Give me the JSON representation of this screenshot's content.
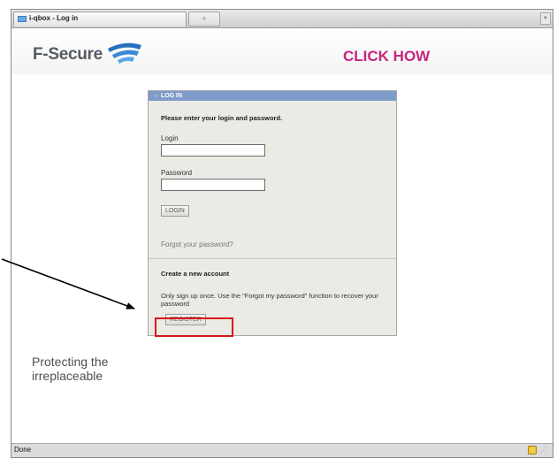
{
  "browser": {
    "tab_title": "i-qbox - Log in",
    "new_tab_glyph": "+",
    "menu_glyph": "▼"
  },
  "header": {
    "brand": "F-Secure",
    "brand_icon": "f-secure-logo-icon",
    "annotation": "CLICK HOW",
    "annotation_color": "#c8247f"
  },
  "login": {
    "panel_title": "→ LOG IN",
    "instructions": "Please enter your login and password.",
    "login_label": "Login",
    "login_value": "",
    "password_label": "Password",
    "password_value": "",
    "login_button": "LOGIN",
    "forgot_link": "Forgot your password?"
  },
  "register": {
    "heading": "Create a new account",
    "description": "Only sign up once. Use the \"Forgot my password\" function to recover your password",
    "register_button": "REGISTER",
    "highlight_color": "#d9141b"
  },
  "tagline": "Protecting the irreplaceable",
  "status": {
    "text": "Done",
    "lock_icon": "lock-icon",
    "grip_glyph": "⋰"
  },
  "colors": {
    "panel_header": "#7f9bc9",
    "panel_bg": "#ebeae5"
  }
}
